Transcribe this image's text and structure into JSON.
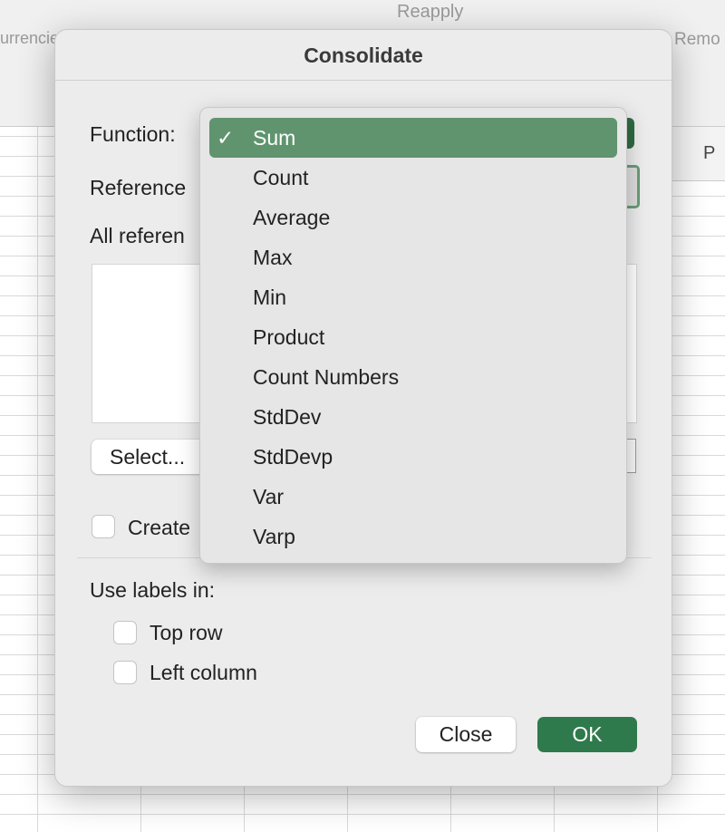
{
  "background": {
    "ribbon_currencies": "urrencie",
    "ribbon_reapply": "Reapply",
    "ribbon_remove": "Remo",
    "column_header": "P"
  },
  "dialog": {
    "title": "Consolidate",
    "function_label": "Function:",
    "reference_label": "Reference",
    "all_references_label": "All referen",
    "select_button": "Select...",
    "create_links_label": "Create",
    "use_labels_label": "Use labels in:",
    "top_row_label": "Top row",
    "left_column_label": "Left column",
    "close_button": "Close",
    "ok_button": "OK",
    "accent_color": "#2f7a4c"
  },
  "function_menu": {
    "selected": "Sum",
    "check_glyph": "✓",
    "items": [
      "Sum",
      "Count",
      "Average",
      "Max",
      "Min",
      "Product",
      "Count Numbers",
      "StdDev",
      "StdDevp",
      "Var",
      "Varp"
    ]
  }
}
